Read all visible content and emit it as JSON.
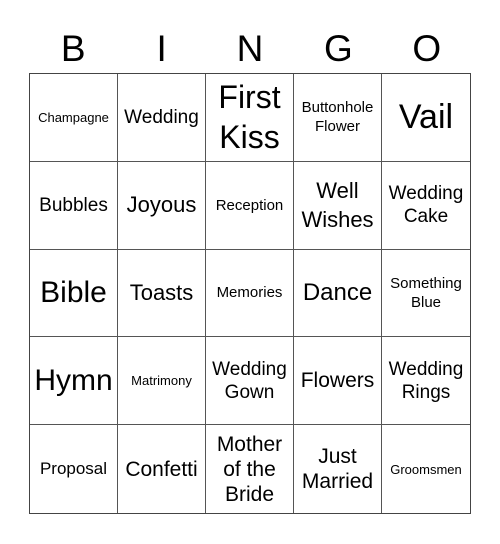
{
  "header": {
    "letters": [
      "B",
      "I",
      "N",
      "G",
      "O"
    ]
  },
  "cells": [
    [
      "Champagne",
      "Wedding",
      "First Kiss",
      "Buttonhole Flower",
      "Vail"
    ],
    [
      "Bubbles",
      "Joyous",
      "Reception",
      "Well Wishes",
      "Wedding Cake"
    ],
    [
      "Bible",
      "Toasts",
      "Memories",
      "Dance",
      "Something Blue"
    ],
    [
      "Hymn",
      "Matrimony",
      "Wedding Gown",
      "Flowers",
      "Wedding Rings"
    ],
    [
      "Proposal",
      "Confetti",
      "Mother of the Bride",
      "Just Married",
      "Groomsmen"
    ]
  ]
}
